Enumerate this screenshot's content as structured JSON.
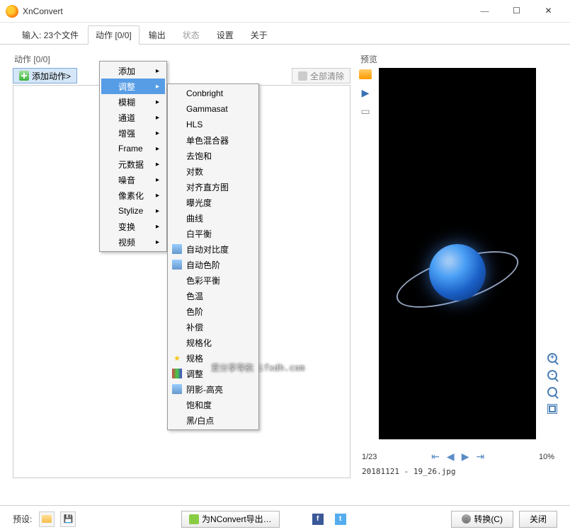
{
  "app": {
    "title": "XnConvert"
  },
  "tabs": {
    "input": "输入: 23个文件",
    "actions": "动作 [0/0]",
    "output": "输出",
    "status": "状态",
    "settings": "设置",
    "about": "关于"
  },
  "left": {
    "panel_label": "动作 [0/0]",
    "add_action": "添加动作>",
    "clear_all": "全部清除"
  },
  "menu1": {
    "items": [
      {
        "label": "添加",
        "arrow": true
      },
      {
        "label": "调整",
        "arrow": true,
        "hl": true
      },
      {
        "label": "模糊",
        "arrow": true
      },
      {
        "label": "通道",
        "arrow": true
      },
      {
        "label": "增强",
        "arrow": true
      },
      {
        "label": "Frame",
        "arrow": true
      },
      {
        "label": "元数据",
        "arrow": true
      },
      {
        "label": "噪音",
        "arrow": true
      },
      {
        "label": "像素化",
        "arrow": true
      },
      {
        "label": "Stylize",
        "arrow": true
      },
      {
        "label": "变换",
        "arrow": true
      },
      {
        "label": "视频",
        "arrow": true
      }
    ]
  },
  "menu2": {
    "items": [
      {
        "label": "Conbright"
      },
      {
        "label": "Gammasat"
      },
      {
        "label": "HLS"
      },
      {
        "label": "单色混合器"
      },
      {
        "label": "去饱和"
      },
      {
        "label": "对数"
      },
      {
        "label": "对齐直方图"
      },
      {
        "label": "曝光度"
      },
      {
        "label": "曲线"
      },
      {
        "label": "白平衡"
      },
      {
        "label": "自动对比度",
        "icon": "img"
      },
      {
        "label": "自动色阶",
        "icon": "img"
      },
      {
        "label": "色彩平衡"
      },
      {
        "label": "色温"
      },
      {
        "label": "色阶"
      },
      {
        "label": "补偿"
      },
      {
        "label": "规格化"
      },
      {
        "label": "规格",
        "icon": "star"
      },
      {
        "label": "调整",
        "icon": "adj"
      },
      {
        "label": "阴影-高亮",
        "icon": "img"
      },
      {
        "label": "饱和度"
      },
      {
        "label": "黑/白点"
      }
    ]
  },
  "preview": {
    "label": "预览",
    "counter": "1/23",
    "zoom": "10%",
    "filename": "20181121 - 19_26.jpg"
  },
  "bottom": {
    "preset": "预设:",
    "export": "为NConvert导出…",
    "convert": "转换(C)",
    "close": "关闭"
  },
  "watermark": "爱分享导航 ifxdh.com"
}
